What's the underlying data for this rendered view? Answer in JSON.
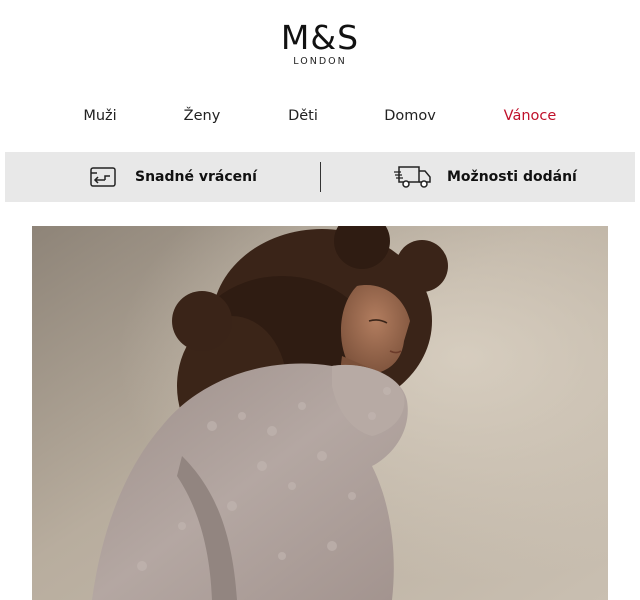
{
  "brand": {
    "name": "M&S",
    "sub": "LONDON"
  },
  "nav": [
    {
      "label": "Muži",
      "color": "#222222"
    },
    {
      "label": "Ženy",
      "color": "#222222"
    },
    {
      "label": "Děti",
      "color": "#222222"
    },
    {
      "label": "Domov",
      "color": "#222222"
    },
    {
      "label": "Vánoce",
      "color": "#c0112b"
    }
  ],
  "service_bar": {
    "returns_label": "Snadné vrácení",
    "returns_icon": "return-card-icon",
    "delivery_label": "Možnosti dodání",
    "delivery_icon": "delivery-truck-icon"
  },
  "colors": {
    "accent": "#c0112b",
    "bar_bg": "#e8e8e8"
  }
}
